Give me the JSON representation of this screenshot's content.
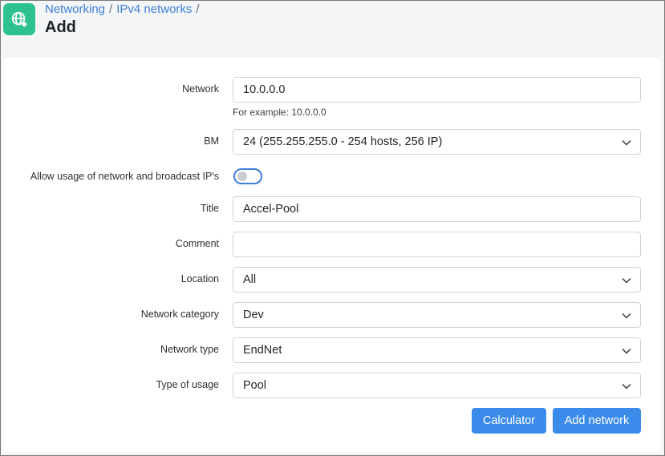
{
  "breadcrumb": {
    "items": [
      "Networking",
      "IPv4 networks"
    ],
    "separator": "/"
  },
  "page": {
    "title": "Add"
  },
  "form": {
    "network": {
      "label": "Network",
      "value": "10.0.0.0",
      "help": "For example: 10.0.0.0"
    },
    "bm": {
      "label": "BM",
      "value": "24 (255.255.255.0 - 254 hosts, 256 IP)"
    },
    "allow_broadcast": {
      "label": "Allow usage of network and broadcast IP's",
      "checked": false
    },
    "title": {
      "label": "Title",
      "value": "Accel-Pool"
    },
    "comment": {
      "label": "Comment",
      "value": ""
    },
    "location": {
      "label": "Location",
      "value": "All"
    },
    "network_category": {
      "label": "Network category",
      "value": "Dev"
    },
    "network_type": {
      "label": "Network type",
      "value": "EndNet"
    },
    "type_of_usage": {
      "label": "Type of usage",
      "value": "Pool"
    }
  },
  "buttons": {
    "calculator": "Calculator",
    "add_network": "Add network"
  },
  "colors": {
    "accent": "#3b8beb",
    "link": "#3d7fd6",
    "app_icon": "#2fc28f"
  },
  "icons": {
    "app": "globe-icon",
    "select": "chevron-down-icon"
  }
}
